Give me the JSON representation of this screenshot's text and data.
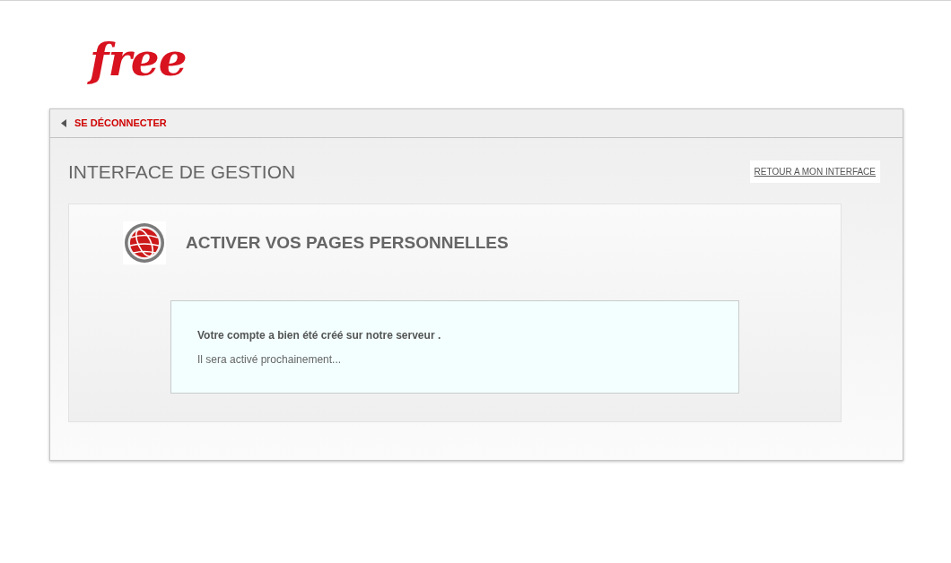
{
  "logo": {
    "text": "free"
  },
  "header": {
    "logout_link": "SE DÉCONNECTER"
  },
  "page": {
    "title": "INTERFACE DE GESTION",
    "back_button": "RETOUR A MON INTERFACE"
  },
  "section": {
    "title": "ACTIVER VOS PAGES PERSONNELLES",
    "message": {
      "title": "Votre compte a bien été créé sur notre serveur .",
      "text": "Il sera activé prochainement..."
    }
  }
}
